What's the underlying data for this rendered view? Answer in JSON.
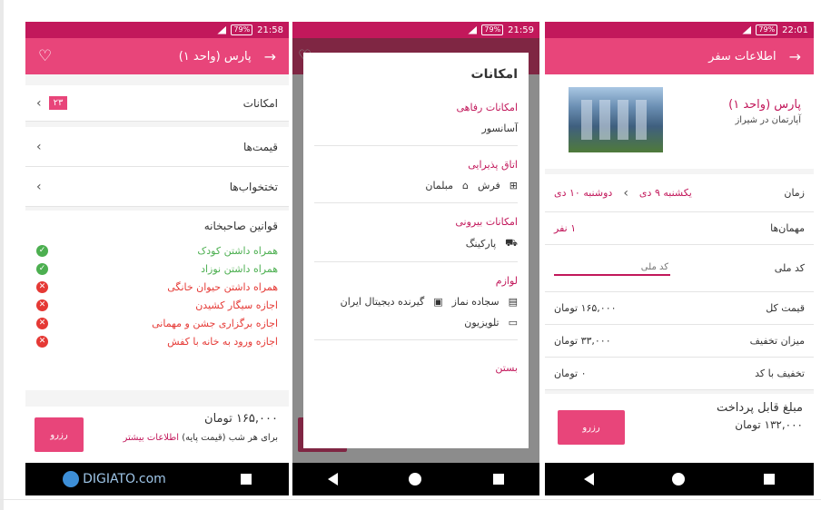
{
  "phone1": {
    "status_time": "21:58",
    "battery": "79%",
    "title": "پارس (واحد ۱)",
    "rows": [
      {
        "label": "امکانات",
        "badge": "۲۳"
      },
      {
        "label": "قیمت‌ها"
      },
      {
        "label": "تختخواب‌ها"
      }
    ],
    "rules_title": "قوانین صاحبخانه",
    "rules": [
      {
        "text": "همراه داشتن کودک",
        "allowed": true
      },
      {
        "text": "همراه داشتن نوزاد",
        "allowed": true
      },
      {
        "text": "همراه داشتن حیوان خانگی",
        "allowed": false
      },
      {
        "text": "اجازه سیگار کشیدن",
        "allowed": false
      },
      {
        "text": "اجازه برگزاری جشن و مهمانی",
        "allowed": false
      },
      {
        "text": "اجازه ورود به خانه با کفش",
        "allowed": false
      }
    ],
    "price": "۱۶۵,۰۰۰ تومان",
    "price_note": "برای هر شب (قیمت پایه)",
    "more_info": "اطلاعات بیشتر",
    "button": "رزرو",
    "brand": "DIGIATO.com"
  },
  "phone2": {
    "status_time": "21:59",
    "battery": "79%",
    "dialog_title": "امکانات",
    "sections": [
      {
        "title": "امکانات رفاهی",
        "items": [
          "آسانسور"
        ]
      },
      {
        "title": "اتاق پذیرایی",
        "items": [
          "فرش",
          "مبلمان"
        ]
      },
      {
        "title": "امکانات بیرونی",
        "items": [
          "پارکینگ"
        ]
      },
      {
        "title": "لوازم",
        "items": [
          "سجاده نماز",
          "گیرنده دیجیتال ایران",
          "تلویزیون"
        ]
      }
    ],
    "close": "بستن"
  },
  "phone3": {
    "status_time": "22:01",
    "battery": "79%",
    "title": "اطلاعات سفر",
    "place_name": "پارس (واحد ۱)",
    "place_sub": "آپارتمان در شیراز",
    "time_label": "زمان",
    "date_from": "یکشنبه ۹ دی",
    "date_to": "دوشنبه ۱۰ دی",
    "guests_label": "مهمان‌ها",
    "guests_value": "۱ نفر",
    "national_code_label": "کد ملی",
    "national_code_placeholder": "کد ملی",
    "total_label": "قیمت کل",
    "total_value": "۱۶۵,۰۰۰ تومان",
    "discount_label": "میزان تخفیف",
    "discount_value": "۳۳,۰۰۰ تومان",
    "code_discount_label": "تخفیف با کد",
    "code_discount_value": "۰ تومان",
    "payable_label": "مبلغ قابل پرداخت",
    "payable_value": "۱۳۲,۰۰۰ تومان",
    "button": "رزرو"
  }
}
